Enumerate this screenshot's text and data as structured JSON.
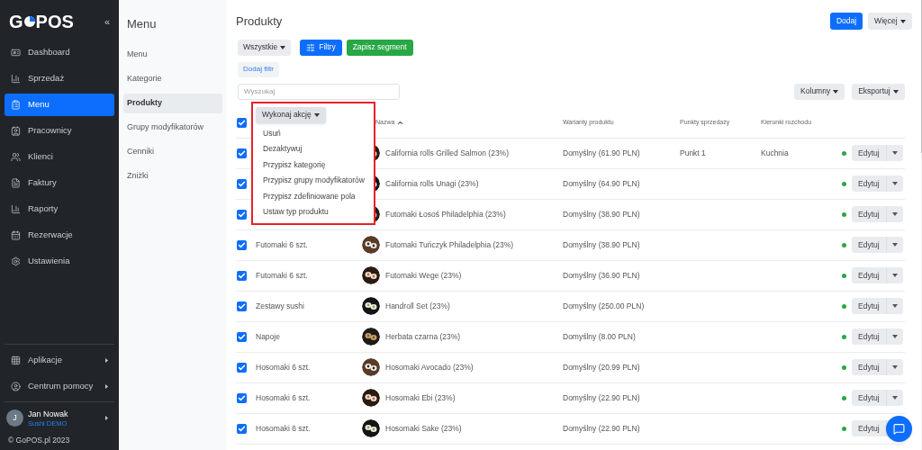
{
  "sidebar": {
    "logo": [
      "G",
      "POS"
    ],
    "collapse": "«",
    "nav": [
      {
        "label": "Dashboard",
        "selected": false
      },
      {
        "label": "Sprzedaż",
        "selected": false
      },
      {
        "label": "Menu",
        "selected": true
      },
      {
        "label": "Pracownicy",
        "selected": false
      },
      {
        "label": "Klienci",
        "selected": false
      },
      {
        "label": "Faktury",
        "selected": false
      },
      {
        "label": "Raporty",
        "selected": false
      },
      {
        "label": "Rezerwacje",
        "selected": false
      },
      {
        "label": "Ustawienia",
        "selected": false
      }
    ],
    "bottom": [
      {
        "label": "Aplikacje"
      },
      {
        "label": "Centrum pomocy"
      }
    ],
    "user": {
      "initial": "J",
      "name": "Jan Nowak",
      "org": "Sushi DEMO"
    },
    "footer": "© GoPOS.pl 2023"
  },
  "submenu": {
    "title": "Menu",
    "items": [
      {
        "label": "Menu",
        "selected": false
      },
      {
        "label": "Kategorie",
        "selected": false
      },
      {
        "label": "Produkty",
        "selected": true
      },
      {
        "label": "Grupy modyfikatorów",
        "selected": false
      },
      {
        "label": "Cenniki",
        "selected": false
      },
      {
        "label": "Zniżki",
        "selected": false
      }
    ]
  },
  "main": {
    "title": "Produkty",
    "add_button": "Dodaj",
    "more_button": "Więcej",
    "segment": "Wszystkie",
    "filters_button": "Filtry",
    "save_segment": "Zapisz segment",
    "add_filter": "Dodaj filtr",
    "search": {
      "placeholder": "Wyszukaj"
    },
    "columns_button": "Kolumny",
    "export_button": "Eksportuj"
  },
  "table": {
    "select_all": true,
    "bulk_action": {
      "label": "Wykonaj akcję",
      "expanded": true,
      "items": [
        "Usuń",
        "Dezaktywuj",
        "Przypisz kategorię",
        "Przypisz grupy modyfikatorów",
        "Przypisz zdefiniowane pola",
        "Ustaw typ produktu"
      ]
    },
    "columns": [
      {
        "label": "Nazwa",
        "sorted": true
      },
      {
        "label": "Warianty produktu",
        "sorted": false
      },
      {
        "label": "Punkty sprzedaży",
        "sorted": false
      },
      {
        "label": "Kierunki rozchodu",
        "sorted": false
      }
    ],
    "rows": [
      {
        "checked": true,
        "name": "California rolls Grilled Salmon (23%)",
        "variant": "Domyślny (61.90 PLN)",
        "points": "Punkt 1",
        "direction": "Kuchnia",
        "active": true,
        "action": "Edytuj"
      },
      {
        "checked": true,
        "name": "California rolls Unagi (23%)",
        "variant": "Domyślny (64.90 PLN)",
        "active": true,
        "action": "Edytuj"
      },
      {
        "checked": true,
        "name": "Futomaki Łosoś Philadelphia (23%)",
        "variant": "Domyślny (38.90 PLN)",
        "active": true,
        "action": "Edytuj"
      },
      {
        "checked": true,
        "category": "Futomaki 6 szt.",
        "name": "Futomaki Tuńczyk Philadelphia (23%)",
        "variant": "Domyślny (38.90 PLN)",
        "active": true,
        "action": "Edytuj"
      },
      {
        "checked": true,
        "category": "Futomaki 6 szt.",
        "name": "Futomaki Wege (23%)",
        "variant": "Domyślny (36.90 PLN)",
        "active": true,
        "action": "Edytuj"
      },
      {
        "checked": true,
        "category": "Zestawy sushi",
        "name": "Handroll Set (23%)",
        "variant": "Domyślny (250.00 PLN)",
        "active": true,
        "action": "Edytuj"
      },
      {
        "checked": true,
        "category": "Napoje",
        "name": "Herbata czarna (23%)",
        "variant": "Domyślny (8.00 PLN)",
        "active": true,
        "action": "Edytuj"
      },
      {
        "checked": true,
        "category": "Hosomaki 6 szt.",
        "name": "Hosomaki Avocado (23%)",
        "variant": "Domyślny (20.99 PLN)",
        "active": true,
        "action": "Edytuj"
      },
      {
        "checked": true,
        "category": "Hosomaki 6 szt.",
        "name": "Hosomaki Ebi (23%)",
        "variant": "Domyślny (22.90 PLN)",
        "active": true,
        "action": "Edytuj"
      },
      {
        "checked": true,
        "category": "Hosomaki 6 szt.",
        "name": "Hosomaki Sake (23%)",
        "variant": "Domyślny (22.90 PLN)",
        "active": true,
        "action": "Edytuj"
      }
    ]
  }
}
